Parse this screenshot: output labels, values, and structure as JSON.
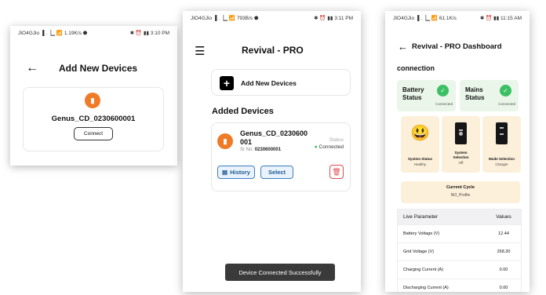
{
  "screen1": {
    "status_left": "JIO4GJio ▐ .▕▁ 📶 1.19K/s ⬟",
    "status_right": "✱ ⏰ ▮▮ 3:10 PM",
    "title": "Add New Devices",
    "device_name": "Genus_CD_0230600001",
    "connect_label": "Connect"
  },
  "screen2": {
    "status_left": "JIO4GJio ▐ .▕▁ 📶 793B/s ⬟",
    "status_right": "✱ ⏰ ▮▮ 3:11 PM",
    "title": "Revival - PRO",
    "add_label": "Add New Devices",
    "section_title": "Added Devices",
    "device": {
      "name": "Genus_CD_0230600001",
      "sr_label": "Sr No:",
      "sr_value": "0230600001",
      "status_label": "Status",
      "status_value": "Connected"
    },
    "history_label": "History",
    "select_label": "Select",
    "toast": "Device Connected Successfully"
  },
  "screen3": {
    "status_left": "JIO4GJio ▐ .▕▁ 📶 61.1K/s",
    "status_right": "✱ ⏰ ▮▮ 11:15 AM",
    "title": "Revival - PRO Dashboard",
    "connection_heading": "connection",
    "battery": {
      "label_1": "Battery",
      "label_2": "Status",
      "state": "Connected"
    },
    "mains": {
      "label_1": "Mains",
      "label_2": "Status",
      "state": "Connected"
    },
    "tiles": [
      {
        "title": "System Status",
        "value": "Healthy"
      },
      {
        "title_1": "System",
        "title_2": "Selection",
        "value": "Off"
      },
      {
        "title": "Mode Selection",
        "value": "Charger"
      }
    ],
    "cycle": {
      "title": "Current Cycle",
      "value": "NO_Profile"
    },
    "table": {
      "headers": [
        "Live Parameter",
        "Values"
      ],
      "rows": [
        [
          "Battery Voltage (V)",
          "12.44"
        ],
        [
          "Grid Voltage (V)",
          "268.30"
        ],
        [
          "Charging Current (A)",
          "0.00"
        ],
        [
          "Discharging Current (A)",
          "0.00"
        ]
      ]
    }
  }
}
